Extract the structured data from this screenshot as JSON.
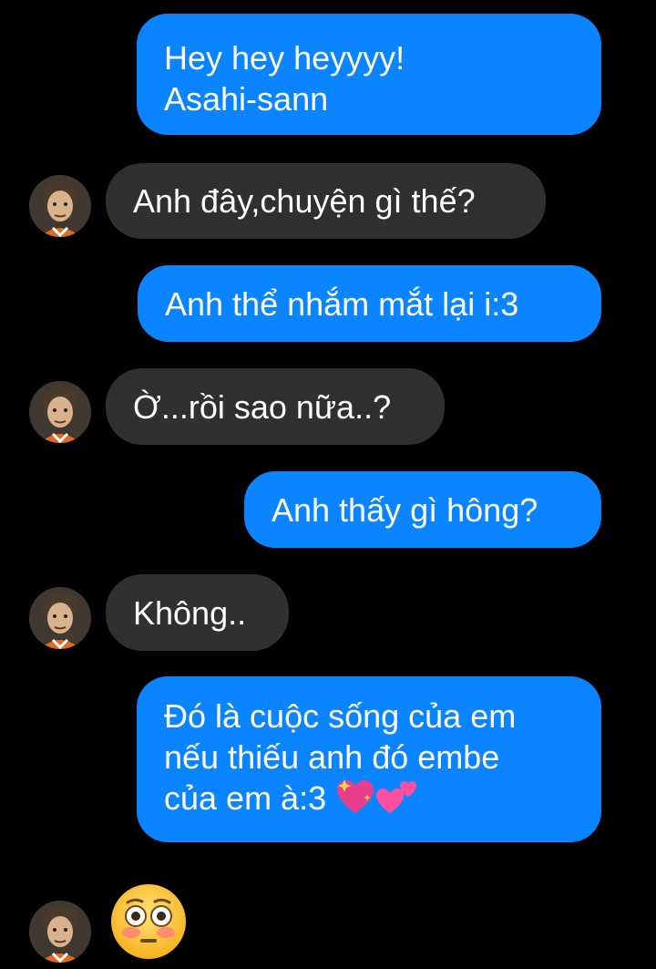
{
  "conversation": {
    "messages": [
      {
        "sender": "me",
        "lines": [
          "Hey hey heyyyy!",
          "Asahi-sann"
        ]
      },
      {
        "sender": "contact",
        "text": "Anh đây,chuyện gì thế?"
      },
      {
        "sender": "me",
        "text": "Anh thể nhắm mắt lại i:3"
      },
      {
        "sender": "contact",
        "text": "Ờ...rồi sao nữa..?"
      },
      {
        "sender": "me",
        "text": "Anh thấy gì hông?"
      },
      {
        "sender": "contact",
        "text": "Không.."
      },
      {
        "sender": "me",
        "lines": [
          "Đó là cuộc sống của em",
          "nếu thiếu anh đó embe",
          "của em à:3"
        ],
        "trailing_emoji": [
          "sparkling-heart",
          "two-hearts"
        ]
      },
      {
        "sender": "contact",
        "emoji": "flushed-face"
      }
    ]
  },
  "colors": {
    "background": "#000000",
    "outgoing_bubble": "#0a84ff",
    "incoming_bubble": "#303030",
    "text": "#ffffff"
  }
}
